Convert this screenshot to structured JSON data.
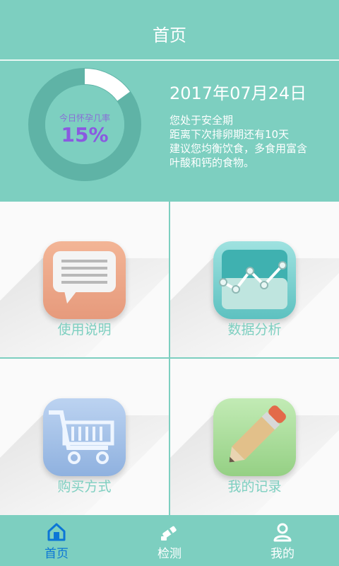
{
  "header": {
    "title": "首页"
  },
  "hero": {
    "ring_label": "今日怀孕几率",
    "probability_text": "15%",
    "probability_value": 0.15,
    "date": "2017年07月24日",
    "lines": [
      "您处于安全期",
      "距离下次排卵期还有10天",
      "建议您均衡饮食，多食用富含",
      "叶酸和钙的食物。"
    ]
  },
  "grid": {
    "items": [
      {
        "label": "使用说明",
        "icon": "chat-bubble-icon"
      },
      {
        "label": "数据分析",
        "icon": "line-chart-icon"
      },
      {
        "label": "购买方式",
        "icon": "shopping-cart-icon"
      },
      {
        "label": "我的记录",
        "icon": "pencil-icon"
      }
    ]
  },
  "tabbar": {
    "tabs": [
      {
        "label": "首页",
        "icon": "home-icon",
        "active": true
      },
      {
        "label": "检测",
        "icon": "test-strip-icon",
        "active": false
      },
      {
        "label": "我的",
        "icon": "user-icon",
        "active": false
      }
    ]
  },
  "colors": {
    "primary": "#7dcfc0",
    "active_tab": "#0b76d6",
    "probability": "#8a5ae0"
  }
}
